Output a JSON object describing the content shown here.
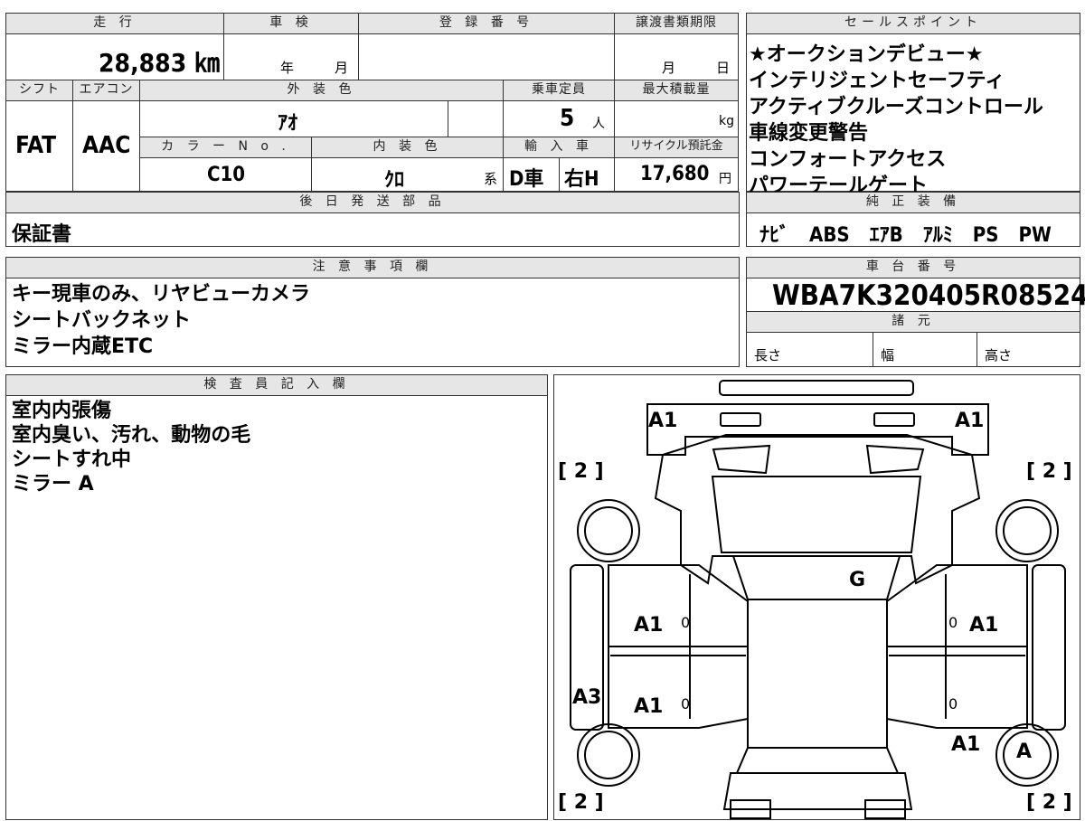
{
  "top_headers": {
    "mileage": "走 行",
    "inspection": "車 検",
    "registration": "登 録 番 号",
    "transfer_deadline": "譲渡書類期限",
    "sales_points": "セールスポイント"
  },
  "mileage": "28,883 ㎞",
  "inspection": {
    "year_unit": "年",
    "month_unit": "月"
  },
  "transfer_deadline": {
    "month_unit": "月",
    "day_unit": "日"
  },
  "row2_headers": {
    "shift": "シフト",
    "aircon": "エアコン",
    "exterior_color": "外 装 色",
    "capacity": "乗車定員",
    "max_load": "最大積載量"
  },
  "shift": "FAT",
  "aircon": "AAC",
  "exterior_color": "ｱｵ",
  "capacity": "5",
  "capacity_unit": "人",
  "load_unit": "kg",
  "row3_headers": {
    "color_no": "カ ラ ー N o .",
    "interior_color": "内 装 色",
    "import": "輸 入 車",
    "recycle": "リサイクル預託金"
  },
  "color_no": "C10",
  "interior_color": "ｸﾛ",
  "interior_suffix": "系",
  "dealer": "D車",
  "handle": "右H",
  "recycle_fee": "17,680",
  "recycle_unit": "円",
  "sales_points": [
    "★オークションデビュー★",
    "インテリジェントセーフティ",
    "アクティブクルーズコントロール",
    "車線変更警告",
    "コンフォートアクセス",
    "パワーテールゲート"
  ],
  "later_parts": {
    "header": "後 日 発 送 部 品",
    "value": "保証書"
  },
  "genuine_equipment": {
    "header": "純 正 装 備",
    "value": "ﾅﾋﾞ　ABS　ｴｱB　ｱﾙﾐ　PS　PW"
  },
  "notes": {
    "header": "注 意 事 項 欄",
    "lines": [
      "キー現車のみ、リヤビューカメラ",
      "シートバックネット",
      "ミラー内蔵ETC"
    ]
  },
  "chassis": {
    "header": "車 台 番 号",
    "value": "WBA7K320405R08524"
  },
  "specs": {
    "header": "諸 元",
    "length": "長さ",
    "width": "幅",
    "height": "高さ"
  },
  "inspector": {
    "header": "検 査 員 記 入 欄",
    "lines": [
      "室内内張傷",
      "室内臭い、汚れ、動物の毛",
      "シートすれ中",
      "ミラー A"
    ]
  },
  "diagram_marks": {
    "front_left": "A1",
    "front_right": "A1",
    "bracket_tl": "[ 2 ]",
    "bracket_tr": "[ 2 ]",
    "bracket_bl": "[ 2 ]",
    "bracket_br": "[ 2 ]",
    "roof": "G",
    "left_front_door": "A1",
    "right_front_door": "A1",
    "left_rear_door": "A1",
    "left_pillar": "A3",
    "right_rear_fender": "A1",
    "rear_right_wheel": "A",
    "zero": "0"
  }
}
